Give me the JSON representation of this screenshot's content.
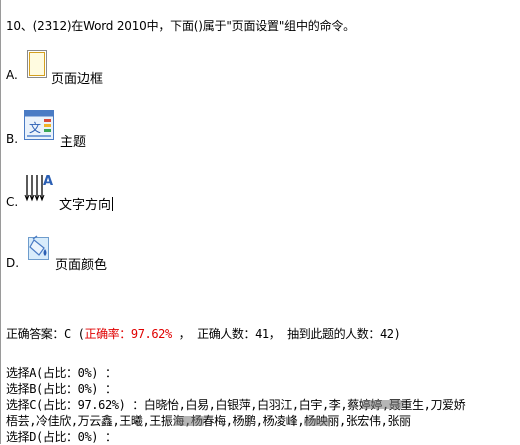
{
  "question": {
    "text": "10、(2312)在Word 2010中，下面()属于\"页面设置\"组中的命令。"
  },
  "options": [
    {
      "letter": "A.",
      "label": "页面边框",
      "icon": "page-borders-icon"
    },
    {
      "letter": "B.",
      "label": "主题",
      "icon": "themes-icon"
    },
    {
      "letter": "C.",
      "label": "文字方向",
      "icon": "text-direction-icon"
    },
    {
      "letter": "D.",
      "label": "页面颜色",
      "icon": "page-color-icon"
    }
  ],
  "answer": {
    "prefix": "正确答案：C (",
    "rate_label": "正确率：97.62%",
    "rest": " ， 正确人数：41， 抽到此题的人数：42)"
  },
  "choices": {
    "a": "选择A(占比：0%) ：",
    "b": "选择B(占比：0%) ：",
    "c": "选择C(占比：97.62%) ：白晓怡,白易,白银萍,白羽江,白宇,李,蔡婷婷,聂重生,刀爱娇",
    "c2": "梧芸,冷佳欣,万云鑫,王曦,王振海,杨春梅,杨鹏,杨凌峰,杨映丽,张宏伟,张丽",
    "d": "选择D(占比：0%) ："
  },
  "colors": {
    "accent_red": "#e00000",
    "icon_blue": "#2b5fb4"
  }
}
